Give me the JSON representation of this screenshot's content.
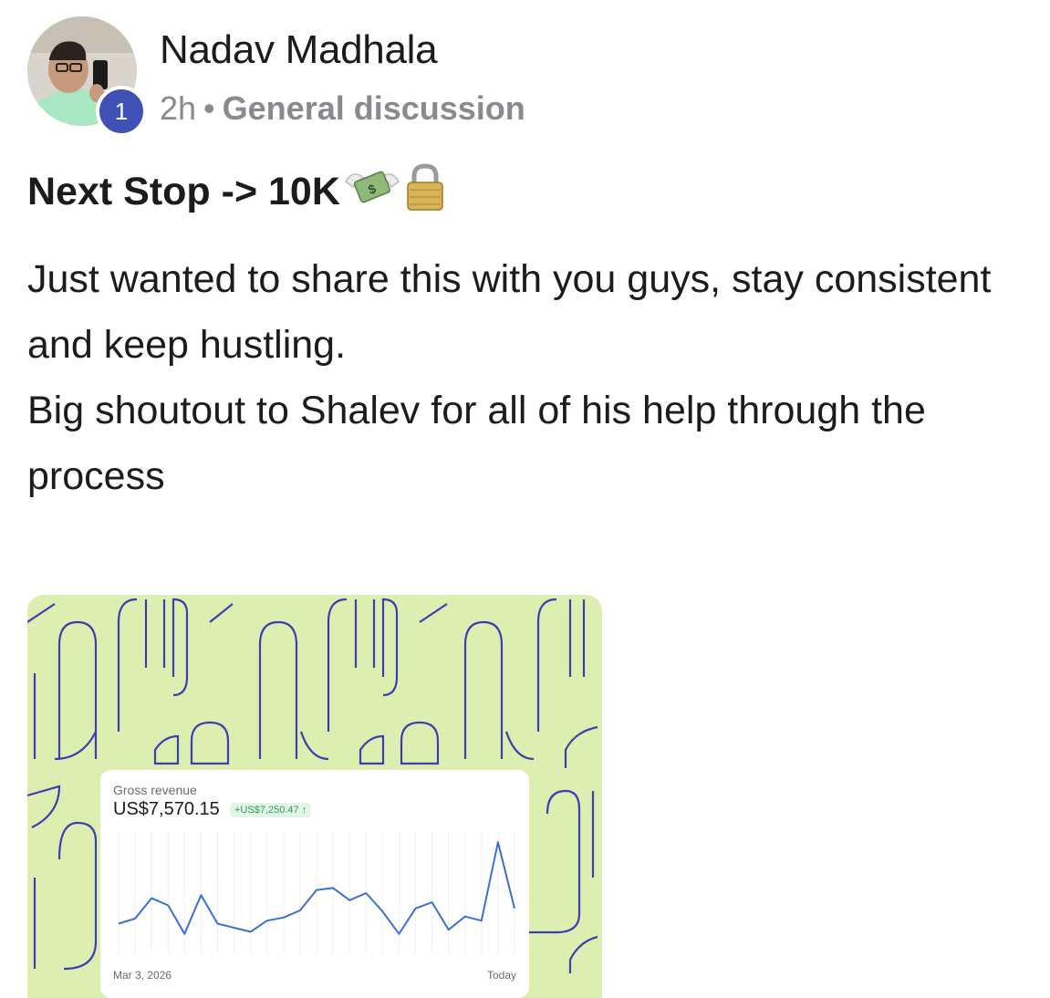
{
  "post": {
    "author": "Nadav Madhala",
    "level": "1",
    "time": "2h",
    "separator": "•",
    "category": "General discussion",
    "title": "Next Stop -> 10K",
    "title_emojis": [
      "money-with-wings-icon",
      "lock-icon"
    ],
    "body_lines": [
      "Just wanted to share this with you guys, stay consistent and keep hustling.",
      "Big shoutout to Shalev for all of his help through the process"
    ]
  },
  "attachment": {
    "card": {
      "label": "Gross revenue",
      "value": "US$7,570.15",
      "delta": "+US$7,250.47 ↑",
      "date_start": "Mar 3, 2026",
      "date_end": "Today"
    }
  },
  "chart_data": {
    "type": "line",
    "title": "Gross revenue",
    "x_start": "Mar 3, 2026",
    "x_end": "Today",
    "series": [
      {
        "values": [
          3,
          3.5,
          5.5,
          4.8,
          2,
          5.8,
          3,
          2.6,
          2.2,
          3.3,
          3.6,
          4.3,
          6.3,
          6.5,
          5.3,
          6,
          4.2,
          2,
          4.5,
          5.1,
          2.4,
          3.7,
          3.3,
          11,
          4.5
        ]
      }
    ],
    "ylim": [
      0,
      12
    ],
    "grid": "vertical",
    "colors": {
      "line": "#3b6fd8"
    }
  },
  "colors": {
    "badge": "#3f51b5",
    "background_pattern": "#dcefb0",
    "pattern_stroke": "#3d3fae",
    "positive": "#2f9e55"
  }
}
